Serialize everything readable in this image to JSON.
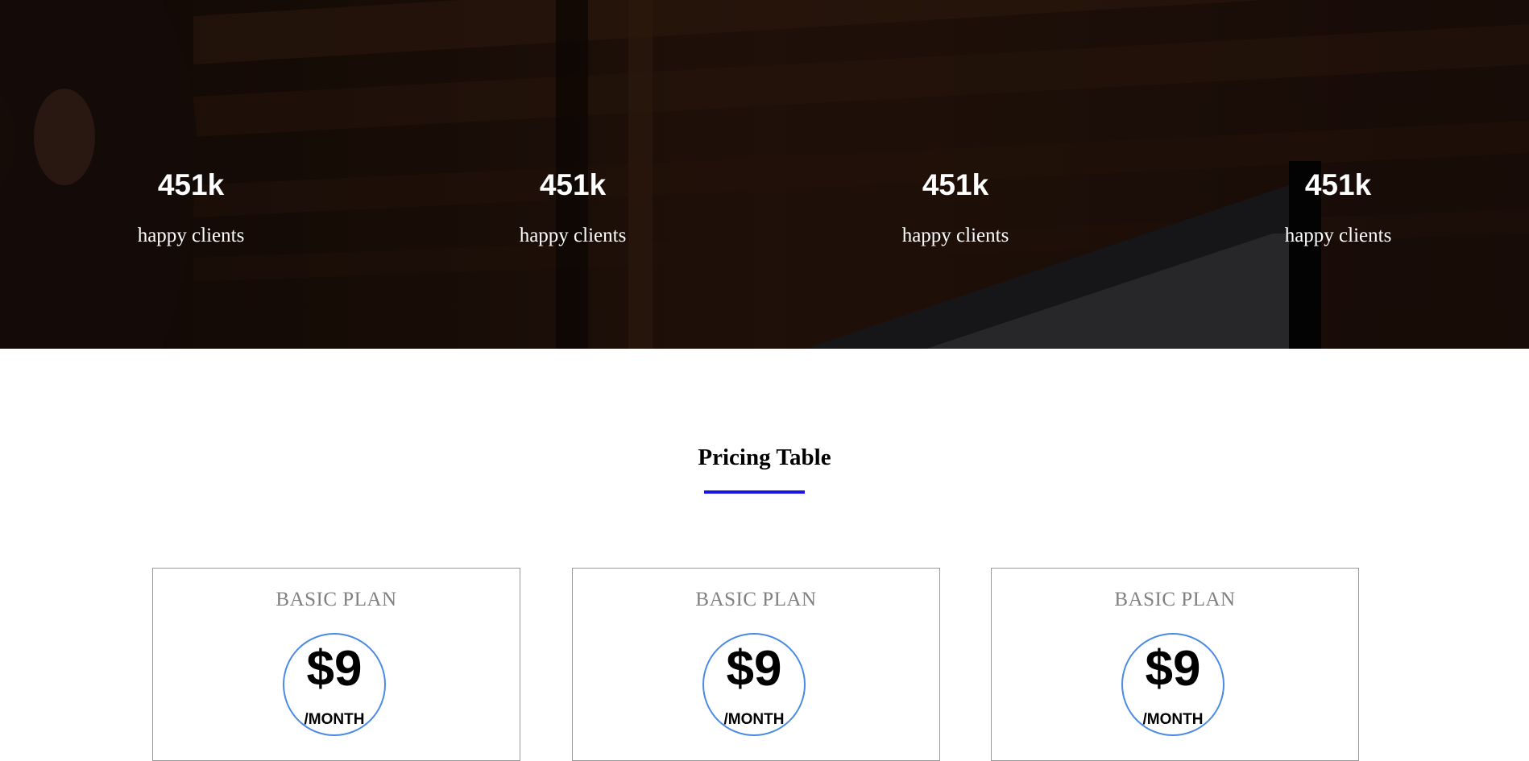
{
  "stats": [
    {
      "number": "451k",
      "label": "happy clients"
    },
    {
      "number": "451k",
      "label": "happy clients"
    },
    {
      "number": "451k",
      "label": "happy clients"
    },
    {
      "number": "451k",
      "label": "happy clients"
    }
  ],
  "pricing": {
    "title": "Pricing Table",
    "accent_color": "#1414e6",
    "plans": [
      {
        "name": "BASIC PLAN",
        "price": "$9",
        "period": "/MONTH"
      },
      {
        "name": "BASIC PLAN",
        "price": "$9",
        "period": "/MONTH"
      },
      {
        "name": "BASIC PLAN",
        "price": "$9",
        "period": "/MONTH"
      }
    ]
  }
}
